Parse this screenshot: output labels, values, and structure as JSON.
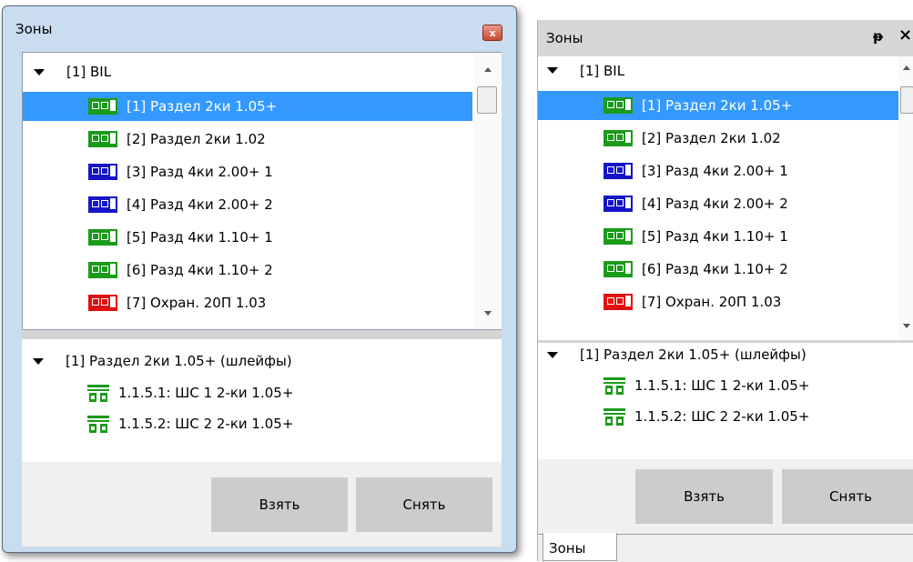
{
  "left": {
    "title": "Зоны",
    "close_glyph": "x",
    "zones_root": "[1] BIL",
    "zones": [
      {
        "label": "[1] Раздел 2ки 1.05+",
        "color": "#1a9b1a",
        "selected": true
      },
      {
        "label": "[2] Раздел 2ки 1.02",
        "color": "#1a9b1a",
        "selected": false
      },
      {
        "label": "[3] Разд 4ки 2.00+ 1",
        "color": "#1515c8",
        "selected": false
      },
      {
        "label": "[4] Разд 4ки 2.00+ 2",
        "color": "#1515c8",
        "selected": false
      },
      {
        "label": "[5] Разд 4ки 1.10+ 1",
        "color": "#1a9b1a",
        "selected": false
      },
      {
        "label": "[6] Разд 4ки 1.10+ 2",
        "color": "#1a9b1a",
        "selected": false
      },
      {
        "label": "[7] Охран. 20П 1.03",
        "color": "#e01010",
        "selected": false
      }
    ],
    "loops_root": "[1] Раздел 2ки 1.05+ (шлейфы)",
    "loops": [
      "1.1.5.1: ШС 1 2-ки 1.05+",
      "1.1.5.2: ШС 2 2-ки 1.05+"
    ],
    "buttons": {
      "take": "Взять",
      "release": "Снять"
    }
  },
  "right": {
    "title": "Зоны",
    "pin_glyph": "ᵽ",
    "close_glyph": "×",
    "zones_root": "[1] BIL",
    "zones": [
      {
        "label": "[1] Раздел 2ки 1.05+",
        "color": "#1a9b1a",
        "selected": true
      },
      {
        "label": "[2] Раздел 2ки 1.02",
        "color": "#1a9b1a",
        "selected": false
      },
      {
        "label": "[3] Разд 4ки 2.00+ 1",
        "color": "#1515c8",
        "selected": false
      },
      {
        "label": "[4] Разд 4ки 2.00+ 2",
        "color": "#1515c8",
        "selected": false
      },
      {
        "label": "[5] Разд 4ки 1.10+ 1",
        "color": "#1a9b1a",
        "selected": false
      },
      {
        "label": "[6] Разд 4ки 1.10+ 2",
        "color": "#1a9b1a",
        "selected": false
      },
      {
        "label": "[7] Охран. 20П 1.03",
        "color": "#e01010",
        "selected": false
      }
    ],
    "loops_root": "[1] Раздел 2ки 1.05+ (шлейфы)",
    "loops": [
      "1.1.5.1: ШС 1 2-ки 1.05+",
      "1.1.5.2: ШС 2 2-ки 1.05+"
    ],
    "buttons": {
      "take": "Взять",
      "release": "Снять"
    },
    "bottom_tab": "Зоны"
  }
}
